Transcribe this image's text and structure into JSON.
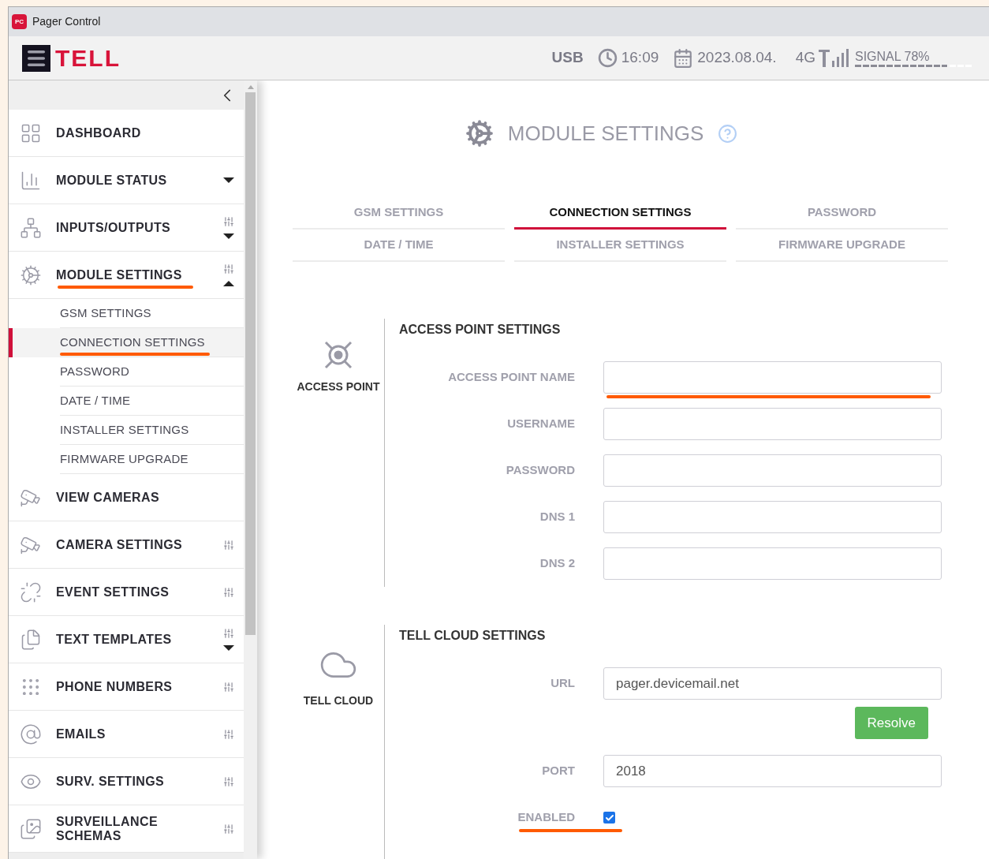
{
  "window": {
    "title": "Pager Control",
    "app_badge": "PC"
  },
  "header": {
    "logo": "TELL",
    "connection": "USB",
    "time": "16:09",
    "date": "2023.08.04.",
    "network": "4G",
    "signal": {
      "label": "SIGNAL 78%",
      "level": 0.78
    }
  },
  "sidebar": {
    "items": [
      {
        "label": "DASHBOARD",
        "settings": false
      },
      {
        "label": "MODULE STATUS",
        "settings": false,
        "expanded": false
      },
      {
        "label": "INPUTS/OUTPUTS",
        "settings": true,
        "expanded": false
      },
      {
        "label": "MODULE SETTINGS",
        "settings": true,
        "expanded": true,
        "highlighted": true,
        "children": [
          {
            "label": "GSM SETTINGS",
            "selected": false,
            "highlighted": false
          },
          {
            "label": "CONNECTION SETTINGS",
            "selected": true,
            "highlighted": true
          },
          {
            "label": "PASSWORD",
            "selected": false,
            "highlighted": false
          },
          {
            "label": "DATE / TIME",
            "selected": false,
            "highlighted": false
          },
          {
            "label": "INSTALLER SETTINGS",
            "selected": false,
            "highlighted": false
          },
          {
            "label": "FIRMWARE UPGRADE",
            "selected": false,
            "highlighted": false
          }
        ]
      },
      {
        "label": "VIEW CAMERAS",
        "settings": false
      },
      {
        "label": "CAMERA SETTINGS",
        "settings": true
      },
      {
        "label": "EVENT SETTINGS",
        "settings": true
      },
      {
        "label": "TEXT TEMPLATES",
        "settings": true,
        "expanded": false
      },
      {
        "label": "PHONE NUMBERS",
        "settings": true
      },
      {
        "label": "EMAILS",
        "settings": true
      },
      {
        "label": "SURV. SETTINGS",
        "settings": true
      },
      {
        "label": "SURVEILLANCE SCHEMAS",
        "settings": true
      }
    ]
  },
  "main": {
    "title": "MODULE SETTINGS",
    "tabs": [
      {
        "label": "GSM SETTINGS",
        "selected": false
      },
      {
        "label": "CONNECTION SETTINGS",
        "selected": true
      },
      {
        "label": "PASSWORD",
        "selected": false
      },
      {
        "label": "DATE / TIME",
        "selected": false
      },
      {
        "label": "INSTALLER SETTINGS",
        "selected": false
      },
      {
        "label": "FIRMWARE UPGRADE",
        "selected": false
      }
    ],
    "sections": [
      {
        "kind": "access_point",
        "icon_label": "ACCESS POINT",
        "title": "ACCESS POINT SETTINGS",
        "fields": [
          {
            "kind": "text",
            "label": "ACCESS POINT NAME",
            "highlighted": true
          },
          {
            "kind": "text",
            "label": "USERNAME",
            "highlighted": false
          },
          {
            "kind": "text",
            "label": "PASSWORD",
            "highlighted": false
          },
          {
            "kind": "text",
            "label": "DNS 1",
            "highlighted": false
          },
          {
            "kind": "text",
            "label": "DNS 2",
            "highlighted": false
          }
        ]
      },
      {
        "kind": "cloud",
        "icon_label": "TELL CLOUD",
        "title": "TELL CLOUD SETTINGS",
        "fields": [
          {
            "kind": "text",
            "label": "URL",
            "value": "pager.devicemail.net",
            "highlighted": false
          },
          {
            "kind": "button",
            "label": "Resolve"
          },
          {
            "kind": "text",
            "label": "PORT",
            "value": "2018",
            "highlighted": false
          },
          {
            "kind": "checkbox",
            "label": "ENABLED",
            "checked": true,
            "highlighted": true
          }
        ]
      }
    ]
  }
}
